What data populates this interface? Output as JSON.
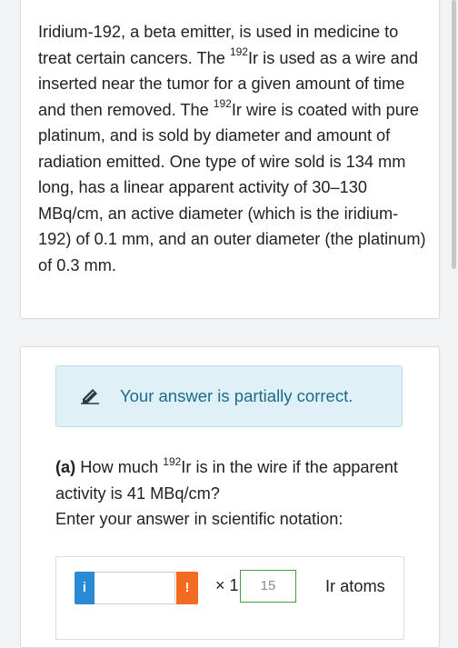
{
  "problem": {
    "line1": "Iridium-192, a beta emitter, is used in medicine to treat certain cancers. The ",
    "sup1": "192",
    "line2": "Ir is used as a wire and inserted near the tumor for a given amount of time and then removed. The ",
    "sup2": "192",
    "line3": "Ir wire is coated with pure platinum, and is sold by diameter and amount of radiation emitted. One type of wire sold is 134 mm long, has a linear apparent activity of 30–130 MBq/cm, an active diameter (which is the iridium-192) of 0.1 mm, and an outer diameter (the platinum) of 0.3 mm."
  },
  "feedback": {
    "text": "Your answer is partially correct.",
    "icon": "pencil-icon",
    "colors": {
      "background": "#dff0f7",
      "text": "#1c6b8a"
    }
  },
  "question": {
    "part_label": "(a)",
    "text_before_sup": " How much ",
    "sup": "192",
    "text_after_sup": "Ir is in the wire if the apparent activity is 41 MBq/cm?",
    "instruction": "Enter your answer in scientific notation:"
  },
  "answer": {
    "info_glyph": "i",
    "info_color": "#2a8ad4",
    "mantissa_value": "",
    "warn_glyph": "!",
    "warn_color": "#f26b21",
    "times_ten": "× 1",
    "exponent_value": "15",
    "units": "Ir atoms"
  }
}
